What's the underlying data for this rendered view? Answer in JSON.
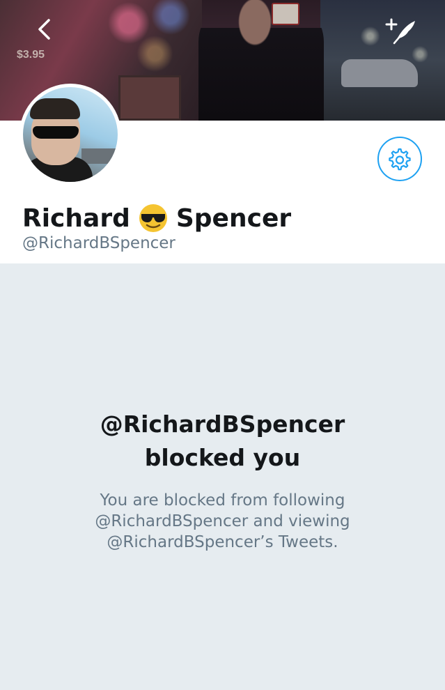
{
  "profile": {
    "display_name_first": "Richard",
    "display_name_emoji": "smiling-face-with-sunglasses-emoji",
    "display_name_last": "Spencer",
    "handle": "@RichardBSpencer"
  },
  "header": {
    "banner_price_text": "$3.95",
    "back_icon": "chevron-left-icon",
    "compose_icon": "compose-tweet-icon"
  },
  "settings": {
    "icon": "gear-icon"
  },
  "blocked": {
    "title_line1": "@RichardBSpencer",
    "title_line2": "blocked you",
    "desc_line1": "You are blocked from following",
    "desc_line2": "@RichardBSpencer and viewing",
    "desc_line3": "@RichardBSpencer’s Tweets."
  },
  "colors": {
    "accent": "#1da1f2",
    "background": "#e6ecf0",
    "primary_text": "#14171a",
    "secondary_text": "#657786"
  }
}
